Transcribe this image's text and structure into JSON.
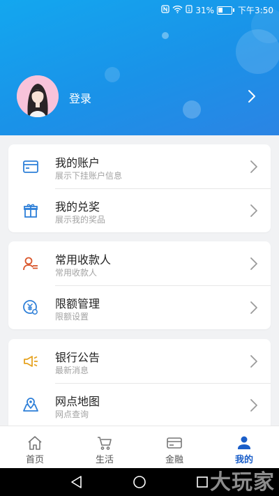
{
  "status_bar": {
    "battery_percent": "31%",
    "time": "下午3:50",
    "battery_level": 0.31,
    "icons": [
      "nfc-icon",
      "wifi-icon",
      "signal-icon",
      "battery-icon"
    ]
  },
  "header": {
    "login_label": "登录",
    "colors": {
      "gradient_start": "#13a7ef",
      "gradient_end": "#2b84e4"
    }
  },
  "sections": [
    {
      "items": [
        {
          "title": "我的账户",
          "subtitle": "展示下挂账户信息",
          "icon": "wallet-icon"
        },
        {
          "title": "我的兑奖",
          "subtitle": "展示我的奖品",
          "icon": "gift-icon"
        }
      ]
    },
    {
      "items": [
        {
          "title": "常用收款人",
          "subtitle": "常用收款人",
          "icon": "payee-icon"
        },
        {
          "title": "限额管理",
          "subtitle": "限额设置",
          "icon": "limit-yen-icon"
        }
      ]
    },
    {
      "items": [
        {
          "title": "银行公告",
          "subtitle": "最新消息",
          "icon": "megaphone-icon"
        },
        {
          "title": "网点地图",
          "subtitle": "网点查询",
          "icon": "map-pin-icon"
        }
      ]
    }
  ],
  "tabbar": {
    "tabs": [
      {
        "label": "首页",
        "icon": "home-icon"
      },
      {
        "label": "生活",
        "icon": "cart-icon"
      },
      {
        "label": "金融",
        "icon": "card-icon"
      },
      {
        "label": "我的",
        "icon": "person-icon",
        "active": true
      }
    ],
    "colors": {
      "active": "#1a5ec9",
      "inactive": "#555555"
    }
  },
  "system_nav": {
    "buttons": [
      "back-icon",
      "home-circle-icon",
      "recents-icon"
    ],
    "watermark": "大玩家"
  }
}
